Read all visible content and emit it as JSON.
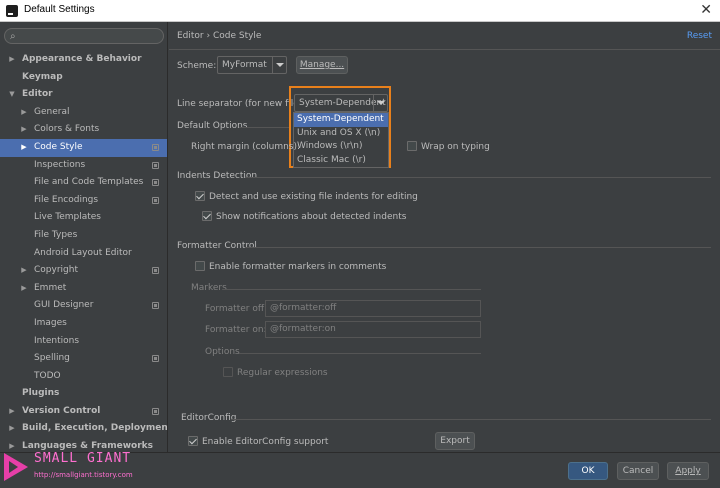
{
  "window": {
    "title": "Default Settings",
    "close_glyph": "✕"
  },
  "sidebar": {
    "search_placeholder": "",
    "items": [
      {
        "label": "Appearance & Behavior",
        "level": 0,
        "arrow": "▶",
        "bold": true
      },
      {
        "label": "Keymap",
        "level": 0,
        "arrow": "",
        "bold": true
      },
      {
        "label": "Editor",
        "level": 0,
        "arrow": "▼",
        "bold": true
      },
      {
        "label": "General",
        "level": 1,
        "arrow": "▶"
      },
      {
        "label": "Colors & Fonts",
        "level": 1,
        "arrow": "▶"
      },
      {
        "label": "Code Style",
        "level": 1,
        "arrow": "▶",
        "selected": true,
        "badge": true
      },
      {
        "label": "Inspections",
        "level": 1,
        "arrow": "",
        "badge": true
      },
      {
        "label": "File and Code Templates",
        "level": 1,
        "arrow": "",
        "badge": true
      },
      {
        "label": "File Encodings",
        "level": 1,
        "arrow": "",
        "badge": true
      },
      {
        "label": "Live Templates",
        "level": 1,
        "arrow": ""
      },
      {
        "label": "File Types",
        "level": 1,
        "arrow": ""
      },
      {
        "label": "Android Layout Editor",
        "level": 1,
        "arrow": ""
      },
      {
        "label": "Copyright",
        "level": 1,
        "arrow": "▶",
        "badge": true
      },
      {
        "label": "Emmet",
        "level": 1,
        "arrow": "▶"
      },
      {
        "label": "GUI Designer",
        "level": 1,
        "arrow": "",
        "badge": true
      },
      {
        "label": "Images",
        "level": 1,
        "arrow": ""
      },
      {
        "label": "Intentions",
        "level": 1,
        "arrow": ""
      },
      {
        "label": "Spelling",
        "level": 1,
        "arrow": "",
        "badge": true
      },
      {
        "label": "TODO",
        "level": 1,
        "arrow": ""
      },
      {
        "label": "Plugins",
        "level": 0,
        "arrow": "",
        "bold": true
      },
      {
        "label": "Version Control",
        "level": 0,
        "arrow": "▶",
        "bold": true,
        "badge": true
      },
      {
        "label": "Build, Execution, Deployment",
        "level": 0,
        "arrow": "▶",
        "bold": true
      },
      {
        "label": "Languages & Frameworks",
        "level": 0,
        "arrow": "▶",
        "bold": true
      }
    ]
  },
  "header": {
    "breadcrumb": "Editor › Code Style",
    "reset": "Reset"
  },
  "scheme": {
    "label": "Scheme:",
    "value": "MyFormat",
    "manage": "Manage..."
  },
  "line_separator": {
    "label": "Line separator (for new files):",
    "value": "System-Dependent",
    "options": [
      "System-Dependent",
      "Unix and OS X (\\n)",
      "Windows (\\r\\n)",
      "Classic Mac (\\r)"
    ],
    "selected_index": 0
  },
  "default_options": {
    "title": "Default Options",
    "right_margin_label": "Right margin (columns):",
    "wrap_on_typing": "Wrap on typing"
  },
  "indents": {
    "title": "Indents Detection",
    "detect": "Detect and use existing file indents for editing",
    "detect_checked": true,
    "notify": "Show notifications about detected indents",
    "notify_checked": true
  },
  "formatter": {
    "title": "Formatter Control",
    "enable": "Enable formatter markers in comments",
    "enable_checked": false,
    "markers_title": "Markers",
    "off_label": "Formatter off:",
    "off_value": "@formatter:off",
    "on_label": "Formatter on:",
    "on_value": "@formatter:on",
    "options_title": "Options",
    "regex": "Regular expressions"
  },
  "editorconfig": {
    "title": "EditorConfig",
    "enable": "Enable EditorConfig support",
    "enable_checked": true,
    "export": "Export"
  },
  "footer": {
    "ok": "OK",
    "cancel": "Cancel",
    "apply": "Apply"
  },
  "watermark": {
    "title": "SMALL GIANT",
    "url": "http://smallgiant.tistory.com"
  },
  "colors": {
    "accent": "#4b6eaf",
    "highlight": "#e8801b",
    "link": "#589df6",
    "watermark": "#ff6fd0"
  }
}
